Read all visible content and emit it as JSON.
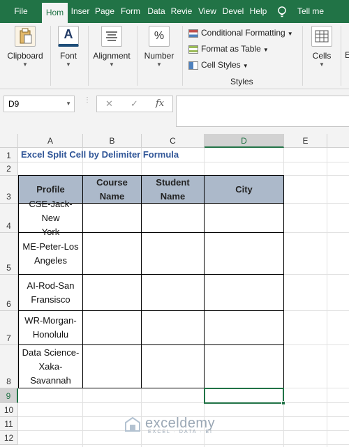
{
  "tabs": [
    {
      "label": "File",
      "active": false
    },
    {
      "label": "Hom",
      "active": true
    },
    {
      "label": "Inser",
      "active": false
    },
    {
      "label": "Page",
      "active": false
    },
    {
      "label": "Form",
      "active": false
    },
    {
      "label": "Data",
      "active": false
    },
    {
      "label": "Revie",
      "active": false
    },
    {
      "label": "View",
      "active": false
    },
    {
      "label": "Devel",
      "active": false
    },
    {
      "label": "Help",
      "active": false
    }
  ],
  "tell_me": "Tell me",
  "ribbon": {
    "clipboard": "Clipboard",
    "font": "Font",
    "font_icon": "A",
    "alignment": "Alignment",
    "number": "Number",
    "number_icon": "%",
    "conditional_formatting": "Conditional Formatting",
    "format_as_table": "Format as Table",
    "cell_styles": "Cell Styles",
    "styles_group": "Styles",
    "cells": "Cells",
    "editing_partial": "E"
  },
  "formula_bar": {
    "name_box": "D9",
    "cancel_glyph": "✕",
    "enter_glyph": "✓",
    "fx_glyph": "fx",
    "formula": ""
  },
  "columns": [
    "A",
    "B",
    "C",
    "D",
    "E"
  ],
  "rows": [
    "1",
    "2",
    "3",
    "4",
    "5",
    "6",
    "7",
    "8",
    "9",
    "10",
    "11",
    "12"
  ],
  "sheet": {
    "title": "Excel Split Cell by Delimiter Formula",
    "headers": [
      [
        "Profile"
      ],
      [
        "Course",
        "Name"
      ],
      [
        "Student",
        "Name"
      ],
      [
        "City"
      ]
    ],
    "profiles": [
      [
        "CSE-Jack-New",
        "York"
      ],
      [
        "ME-Peter-Los",
        "Angeles"
      ],
      [
        "AI-Rod-San",
        "Fransisco"
      ],
      [
        "WR-Morgan-",
        "Honolulu"
      ],
      [
        "Data Science-",
        "Xaka-",
        "Savannah"
      ]
    ]
  },
  "watermark": {
    "name": "exceldemy",
    "tagline": "EXCEL · DATA · BI"
  },
  "colors": {
    "excel_green": "#217346",
    "header_fill": "#acb9ca",
    "title_text": "#2f5597"
  }
}
